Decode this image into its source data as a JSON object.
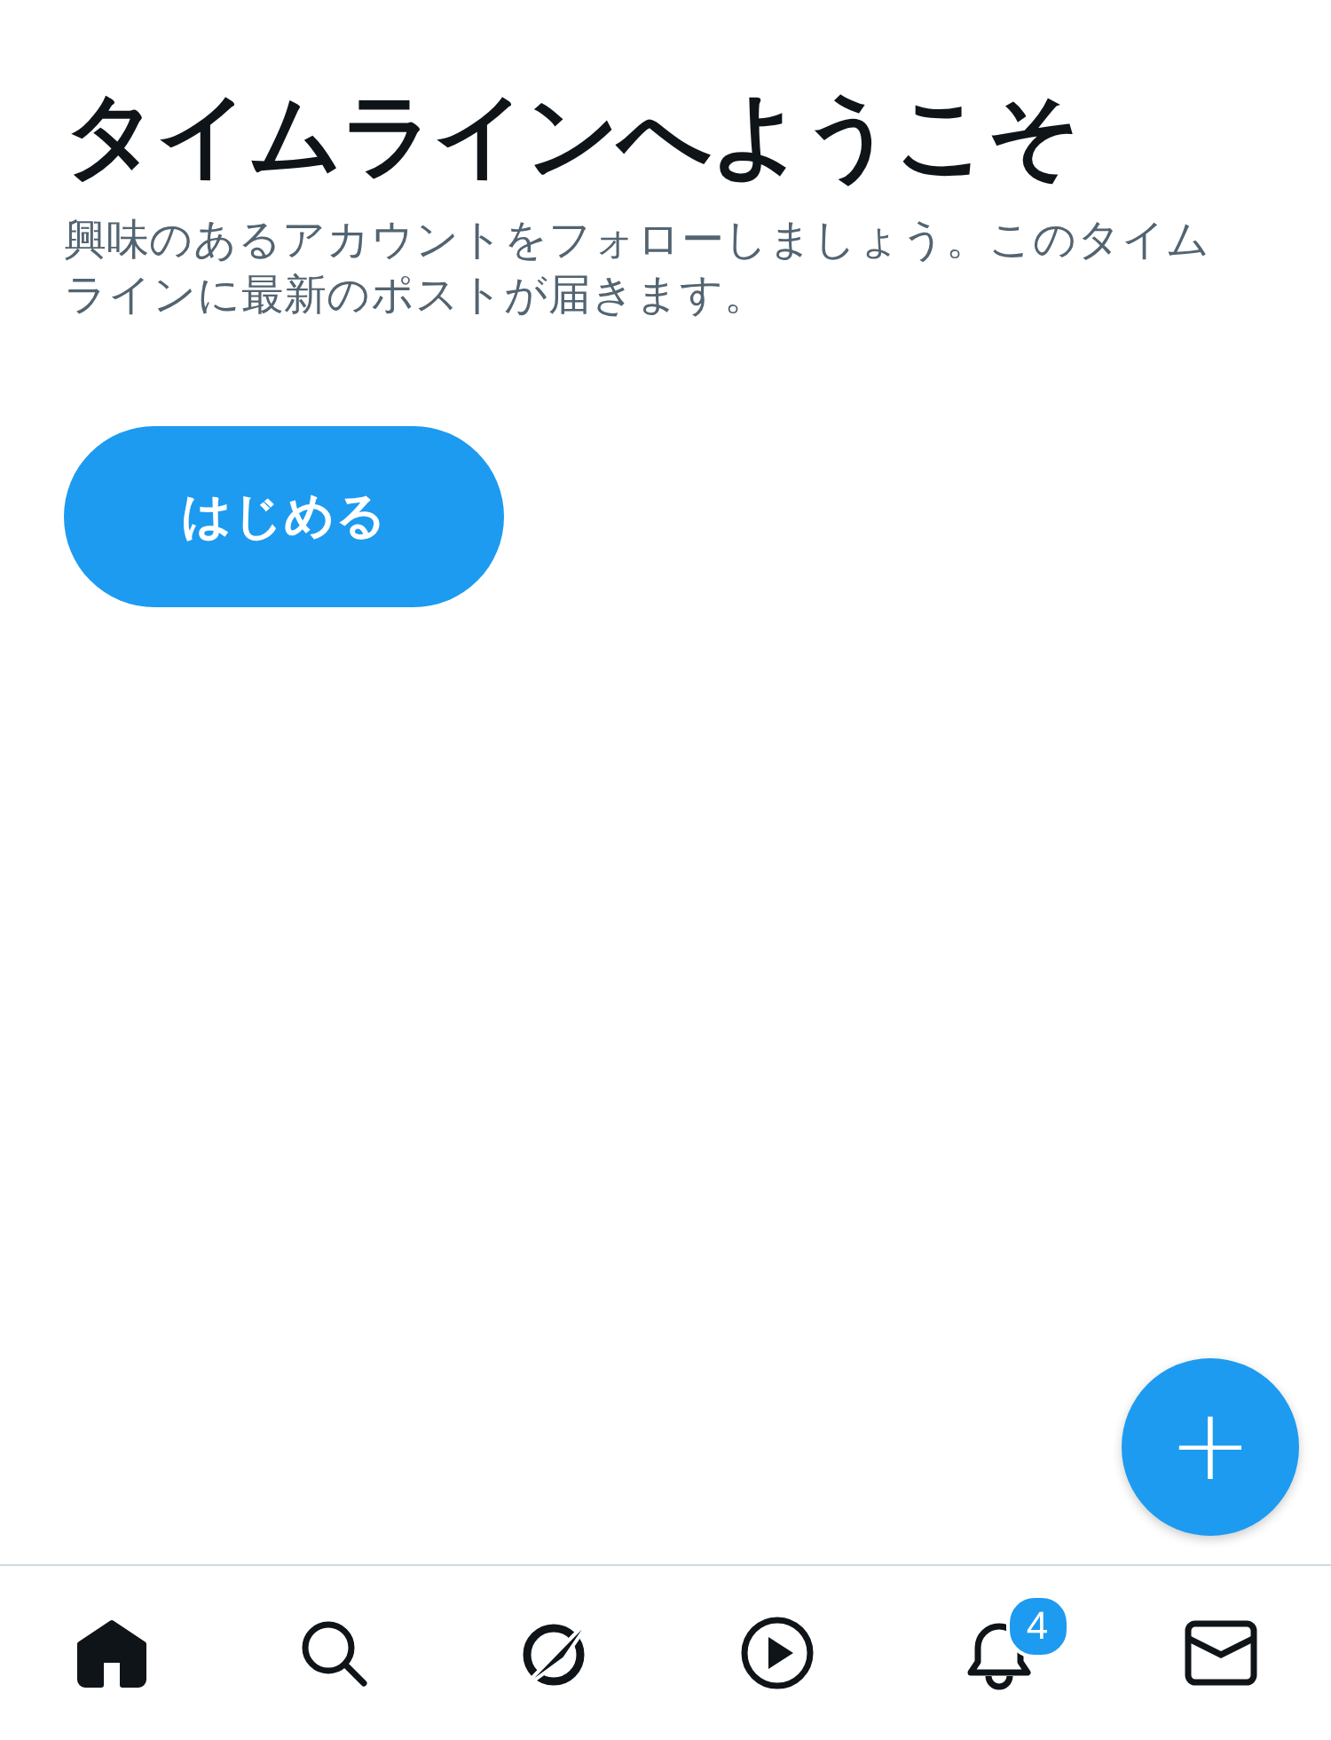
{
  "title": "タイムラインへようこそ",
  "description": "興味のあるアカウントをフォローしましょう。このタイムラインに最新のポストが届きます。",
  "start_button": "はじめる",
  "compose_button": "+",
  "nav": [
    {
      "kind": "home",
      "selected": true
    },
    {
      "kind": "search",
      "selected": false
    },
    {
      "kind": "grok",
      "selected": false
    },
    {
      "kind": "video",
      "selected": false
    },
    {
      "kind": "notifications",
      "selected": false,
      "badge": "4"
    },
    {
      "kind": "messages",
      "selected": false
    }
  ]
}
